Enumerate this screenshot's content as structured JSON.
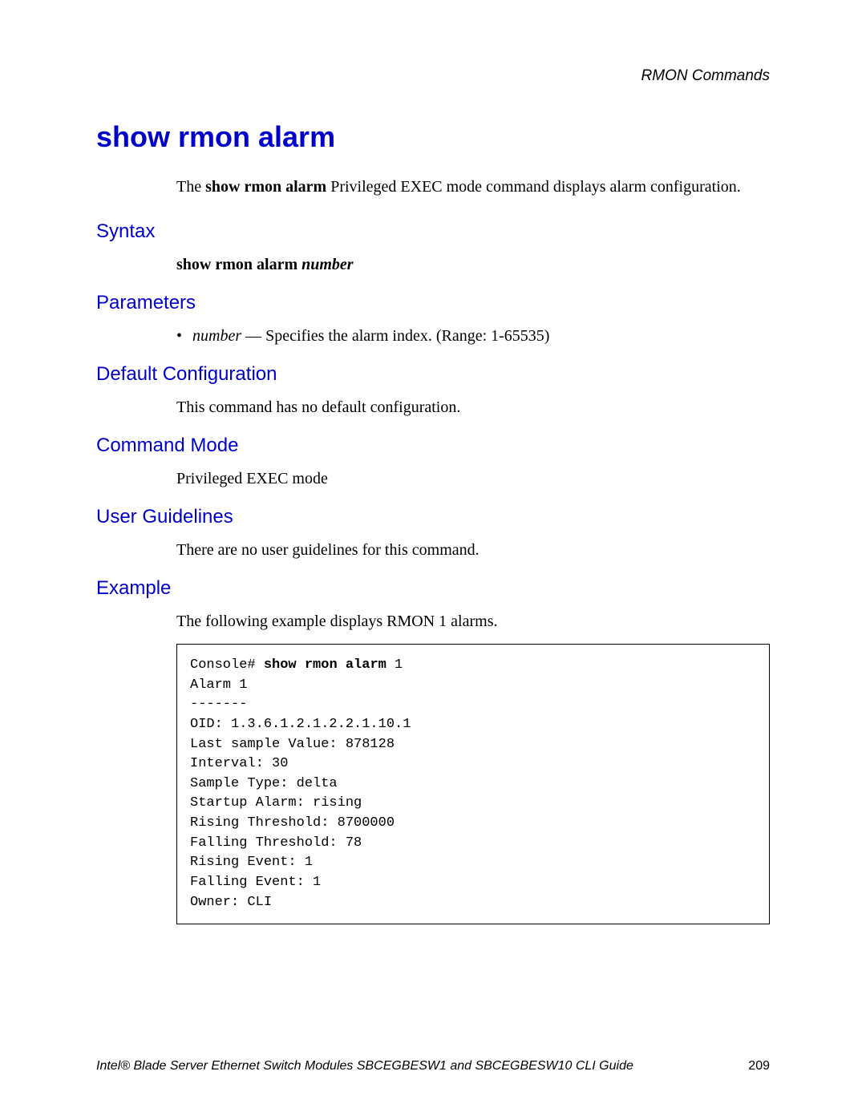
{
  "header": {
    "section": "RMON Commands"
  },
  "title": "show rmon alarm",
  "intro": {
    "prefix": "The ",
    "cmd": "show rmon alarm",
    "suffix": " Privileged EXEC mode command displays alarm configuration."
  },
  "sections": {
    "syntax": {
      "heading": "Syntax",
      "cmd_bold": "show rmon alarm ",
      "cmd_italic": "number"
    },
    "parameters": {
      "heading": "Parameters",
      "bullet": "•  ",
      "param_name": "number",
      "param_desc": " — Specifies the alarm index. (Range: 1-65535)"
    },
    "default_config": {
      "heading": "Default Configuration",
      "text": "This command has no default configuration."
    },
    "command_mode": {
      "heading": "Command Mode",
      "text": "Privileged EXEC mode"
    },
    "user_guidelines": {
      "heading": "User Guidelines",
      "text": "There are no user guidelines for this command."
    },
    "example": {
      "heading": "Example",
      "text": "The following example displays RMON 1 alarms.",
      "code_prompt": "Console# ",
      "code_cmd": "show rmon alarm",
      "code_arg": " 1",
      "code_body": "Alarm 1\n-------\nOID: 1.3.6.1.2.1.2.2.1.10.1\nLast sample Value: 878128\nInterval: 30\nSample Type: delta\nStartup Alarm: rising\nRising Threshold: 8700000\nFalling Threshold: 78\nRising Event: 1\nFalling Event: 1\nOwner: CLI"
    }
  },
  "footer": {
    "doc": "Intel® Blade Server Ethernet Switch Modules SBCEGBESW1 and SBCEGBESW10 CLI Guide",
    "page": "209"
  }
}
